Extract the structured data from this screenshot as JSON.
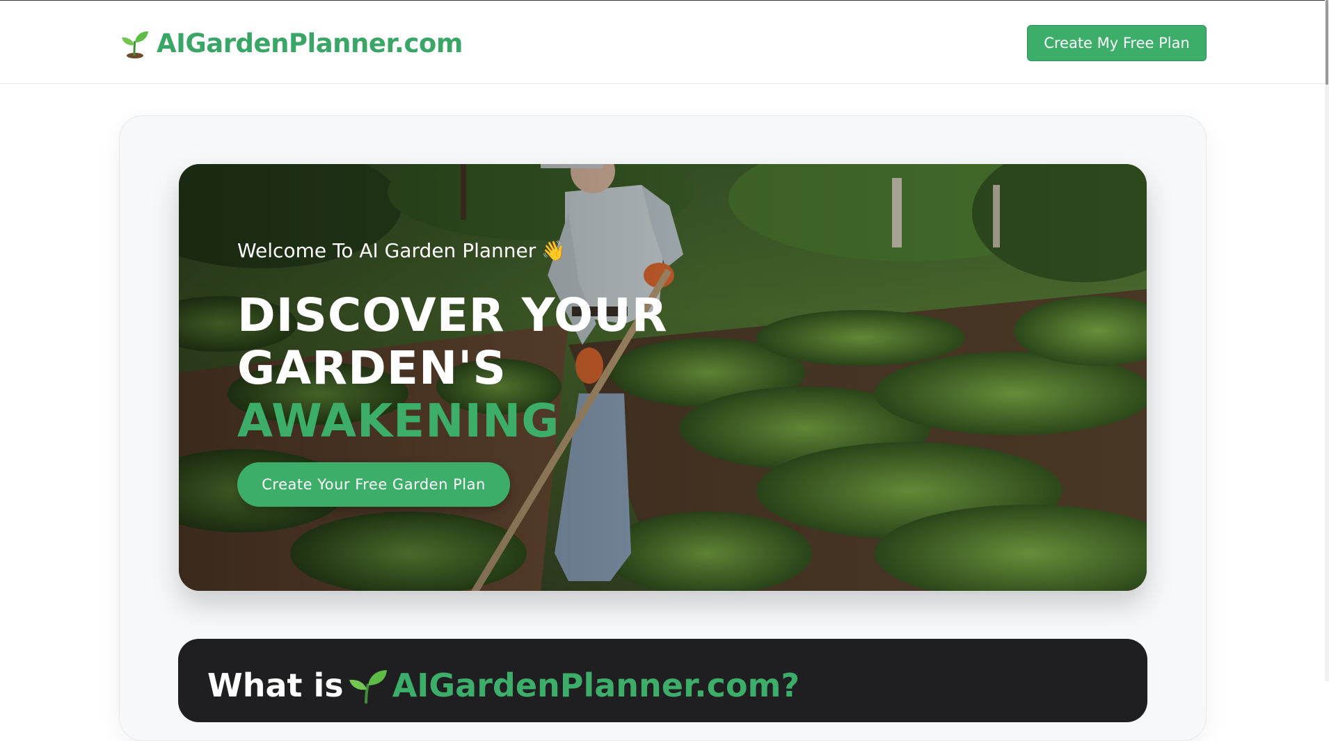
{
  "header": {
    "logo_text": "AIGardenPlanner.com",
    "logo_icon": "seedling-icon",
    "cta_label": "Create My Free Plan"
  },
  "hero": {
    "welcome": "Welcome To AI Garden Planner",
    "welcome_icon": "waving-hand-icon",
    "title_line1": "DISCOVER YOUR",
    "title_line2": "GARDEN'S",
    "title_accent": "AWAKENING",
    "button_label": "Create Your Free Garden Plan",
    "background": "photo-of-gardener-hoeing-vegetable-rows"
  },
  "about": {
    "title_prefix": "What is",
    "title_brand": "AIGardenPlanner.com?",
    "title_icon": "seedling-icon"
  },
  "colors": {
    "brand_green": "#3cae6a",
    "dark_section": "#1f1f21",
    "card_background": "#f7f8fa"
  }
}
